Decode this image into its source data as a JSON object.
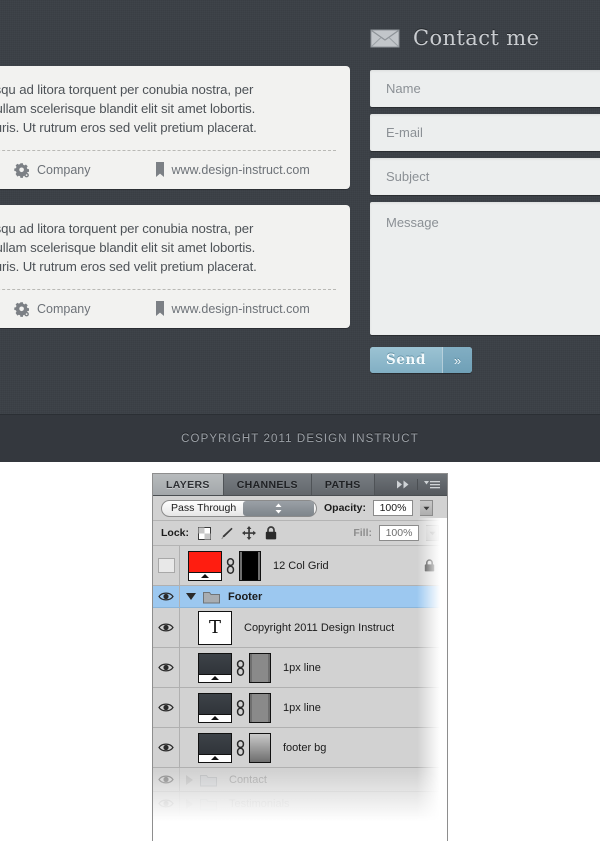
{
  "mockup": {
    "testimonials": [
      {
        "lines": [
          "i sociosqu ad litora torquent per conubia nostra, per",
          "eos. Nullam scelerisque blandit elit sit amet lobortis.",
          "tor mauris. Ut rutrum eros sed velit pretium placerat."
        ],
        "company": "Company",
        "url": "www.design-instruct.com"
      },
      {
        "lines": [
          "i sociosqu ad litora torquent per conubia nostra, per",
          "eos. Nullam scelerisque blandit elit sit amet lobortis.",
          "tor mauris. Ut rutrum eros sed velit pretium placerat."
        ],
        "company": "Company",
        "url": "www.design-instruct.com"
      }
    ],
    "contact": {
      "heading": "Contact me",
      "icon": "envelope-icon",
      "fields": [
        {
          "name": "name",
          "placeholder": "Name",
          "value": ""
        },
        {
          "name": "email",
          "placeholder": "E-mail",
          "value": ""
        },
        {
          "name": "subject",
          "placeholder": "Subject",
          "value": ""
        }
      ],
      "message": {
        "placeholder": "Message",
        "value": ""
      },
      "send_label": "Send",
      "send_arrow": "»",
      "send_color": "#8ab6c9"
    },
    "footer": {
      "copyright": "COPYRIGHT 2011 DESIGN INSTRUCT"
    },
    "colors": {
      "background": "#3b4046",
      "footer_bar": "#34383e",
      "card": "#f2f2f0"
    }
  },
  "photoshop": {
    "tabs": [
      {
        "label": "LAYERS",
        "active": true
      },
      {
        "label": "CHANNELS",
        "active": false
      },
      {
        "label": "PATHS",
        "active": false
      }
    ],
    "header_icons": [
      "collapse-chevrons-icon",
      "panel-menu-icon"
    ],
    "blend_mode": "Pass Through",
    "opacity_label": "Opacity:",
    "opacity_value": "100%",
    "lock_label": "Lock:",
    "lock_icons": [
      "lock-transparency-icon",
      "lock-image-icon",
      "lock-position-icon",
      "lock-all-icon"
    ],
    "fill_label": "Fill:",
    "fill_value": "100%",
    "selection_color": "#9cc8f0",
    "layers": [
      {
        "type": "layer",
        "name": "12 Col Grid",
        "visible": false,
        "locked": true,
        "thumb": "red",
        "mask": "black",
        "linked": true,
        "opacity": 1
      },
      {
        "type": "group",
        "name": "Footer",
        "visible": true,
        "expanded": true,
        "selected": true,
        "opacity": 1
      },
      {
        "type": "text",
        "name": "Copyright 2011 Design Instruct",
        "visible": true,
        "thumb": "text-T",
        "child": true,
        "opacity": 1
      },
      {
        "type": "layer",
        "name": "1px line",
        "visible": true,
        "thumb": "gradient",
        "mask": "gray",
        "linked": true,
        "child": true,
        "opacity": 1
      },
      {
        "type": "layer",
        "name": "1px line",
        "visible": true,
        "thumb": "gradient",
        "mask": "gray",
        "linked": true,
        "child": true,
        "opacity": 1
      },
      {
        "type": "layer",
        "name": "footer bg",
        "visible": true,
        "thumb": "gradient",
        "mask": "gradient",
        "linked": true,
        "child": true,
        "opacity": 1
      },
      {
        "type": "group",
        "name": "Contact",
        "visible": true,
        "expanded": false,
        "opacity": 0.42
      },
      {
        "type": "group",
        "name": "Testimonials",
        "visible": true,
        "expanded": false,
        "opacity": 0.18
      }
    ]
  }
}
